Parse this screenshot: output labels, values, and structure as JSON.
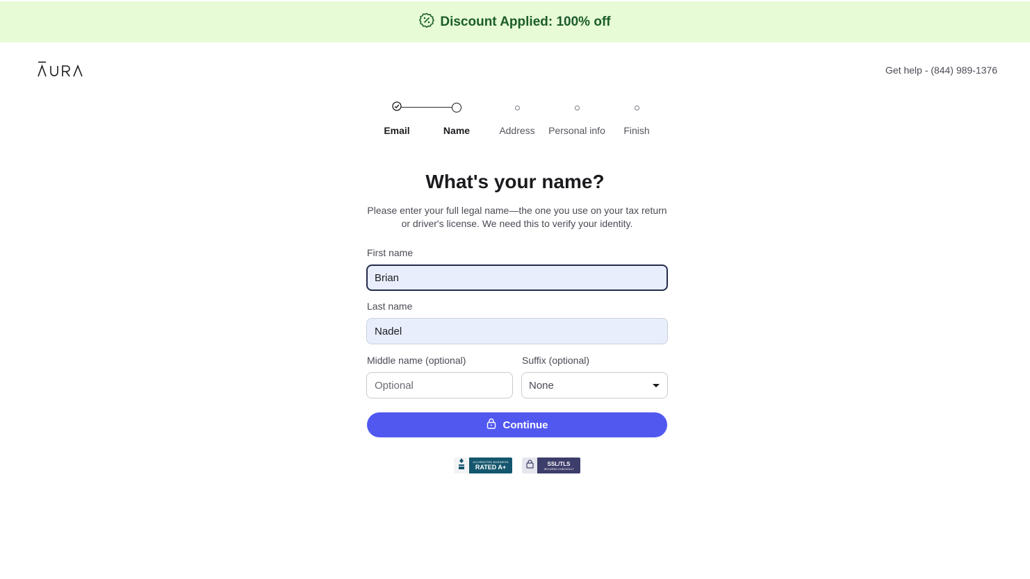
{
  "banner": {
    "text": "Discount Applied: 100% off",
    "icon": "discount-badge-icon",
    "background": "#e6fbd6",
    "text_color": "#1c5c2c"
  },
  "header": {
    "logo_text": "AURA",
    "help_text": "Get help - (844) 989-1376"
  },
  "stepper": {
    "steps": [
      {
        "label": "Email",
        "state": "completed"
      },
      {
        "label": "Name",
        "state": "current"
      },
      {
        "label": "Address",
        "state": "upcoming"
      },
      {
        "label": "Personal info",
        "state": "upcoming"
      },
      {
        "label": "Finish",
        "state": "upcoming"
      }
    ]
  },
  "form": {
    "title": "What's your name?",
    "subtitle_line1": "Please enter your full legal name—the one you use on your tax return",
    "subtitle_line2": "or driver's license. We need this to verify your identity.",
    "first_name": {
      "label": "First name",
      "value": "Brian"
    },
    "last_name": {
      "label": "Last name",
      "value": "Nadel"
    },
    "middle_name": {
      "label": "Middle name (optional)",
      "value": "",
      "placeholder": "Optional"
    },
    "suffix": {
      "label": "Suffix (optional)",
      "selected": "None"
    },
    "continue_label": "Continue",
    "accent_color": "#5158f0"
  },
  "badges": {
    "bbb": {
      "top": "ACCREDITED BUSINESS",
      "bottom": "RATED A+"
    },
    "ssl": {
      "top": "SSL/TLS",
      "bottom": "SECURED CHECKOUT"
    }
  }
}
